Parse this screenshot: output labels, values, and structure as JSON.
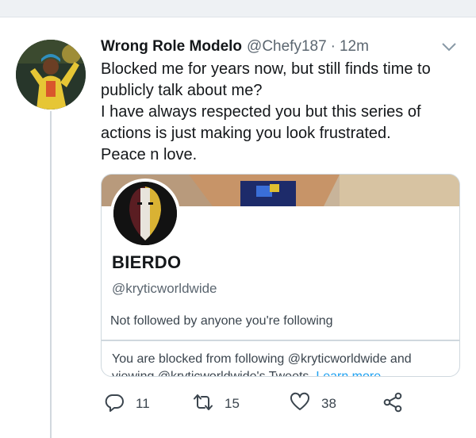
{
  "tweet": {
    "display_name": "Wrong Role Modelo",
    "handle": "@Chefy187",
    "separator": "·",
    "time": "12m",
    "text_lines": [
      "Blocked me for years now, but still finds time to",
      "publicly talk about me?",
      "I have always respected you but this series of",
      "actions is just making you look frustrated.",
      "Peace n love."
    ]
  },
  "card": {
    "name": "BIERDO",
    "handle": "@kryticworldwide",
    "follow_status": "Not followed by anyone you're following",
    "blocked_line1": "You are blocked from following @kryticworldwide and",
    "blocked_line2_prefix": "viewing @kryticworldwide's Tweets.",
    "learn_more": "Learn more"
  },
  "actions": {
    "replies": "11",
    "retweets": "15",
    "likes": "38"
  },
  "colors": {
    "link": "#1da1f2",
    "secondary_text": "#5b6670",
    "border": "#cfd8de"
  }
}
